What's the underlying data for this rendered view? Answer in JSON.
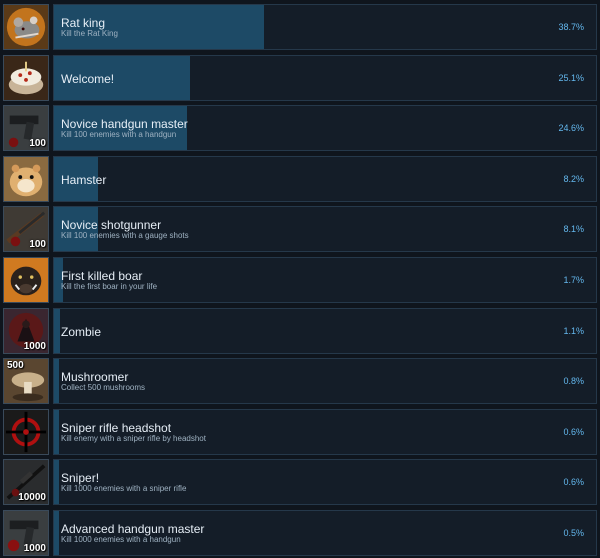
{
  "achievements": [
    {
      "title": "Rat king",
      "description": "Kill the Rat King",
      "percent_label": "38.7%",
      "percent": 38.7,
      "badge": "",
      "icon": "rat-king-icon"
    },
    {
      "title": "Welcome!",
      "description": "",
      "percent_label": "25.1%",
      "percent": 25.1,
      "badge": "",
      "icon": "welcome-cake-icon"
    },
    {
      "title": "Novice handgun master",
      "description": "Kill 100 enemies with a handgun",
      "percent_label": "24.6%",
      "percent": 24.6,
      "badge": "100",
      "icon": "handgun-icon"
    },
    {
      "title": "Hamster",
      "description": "",
      "percent_label": "8.2%",
      "percent": 8.2,
      "badge": "",
      "icon": "hamster-icon"
    },
    {
      "title": "Novice shotgunner",
      "description": "Kill 100 enemies with a gauge shots",
      "percent_label": "8.1%",
      "percent": 8.1,
      "badge": "100",
      "icon": "shotgun-icon"
    },
    {
      "title": "First killed boar",
      "description": "Kill the first boar in your life",
      "percent_label": "1.7%",
      "percent": 1.7,
      "badge": "",
      "icon": "boar-icon"
    },
    {
      "title": "Zombie",
      "description": "",
      "percent_label": "1.1%",
      "percent": 1.1,
      "badge": "1000",
      "icon": "zombie-icon"
    },
    {
      "title": "Mushroomer",
      "description": "Collect 500 mushrooms",
      "percent_label": "0.8%",
      "percent": 0.8,
      "badge": "500",
      "icon": "mushroom-icon"
    },
    {
      "title": "Sniper rifle headshot",
      "description": "Kill enemy with a sniper rifle by headshot",
      "percent_label": "0.6%",
      "percent": 0.6,
      "badge": "",
      "icon": "crosshair-icon"
    },
    {
      "title": "Sniper!",
      "description": "Kill 1000 enemies with a sniper rifle",
      "percent_label": "0.6%",
      "percent": 0.6,
      "badge": "10000",
      "icon": "sniper-rifle-icon"
    },
    {
      "title": "Advanced handgun master",
      "description": "Kill 1000 enemies with a handgun",
      "percent_label": "0.5%",
      "percent": 0.5,
      "badge": "1000",
      "icon": "handgun-advanced-icon"
    }
  ]
}
